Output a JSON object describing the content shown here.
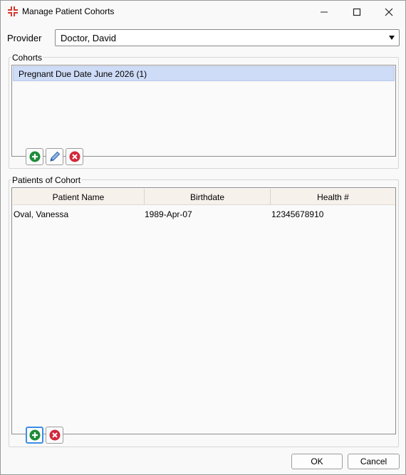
{
  "window": {
    "title": "Manage Patient Cohorts"
  },
  "provider": {
    "label": "Provider",
    "selected": "Doctor, David"
  },
  "cohorts": {
    "label": "Cohorts",
    "items": [
      {
        "label": "Pregnant Due Date June 2026 (1)",
        "selected": true
      }
    ],
    "add_icon": "plus-circle-icon",
    "edit_icon": "pencil-icon",
    "remove_icon": "x-circle-icon"
  },
  "patients": {
    "label": "Patients of Cohort",
    "columns": [
      "Patient Name",
      "Birthdate",
      "Health #"
    ],
    "rows": [
      [
        "Oval, Vanessa",
        "1989-Apr-07",
        "12345678910"
      ]
    ]
  },
  "footer": {
    "ok": "OK",
    "cancel": "Cancel"
  },
  "colors": {
    "selection": "#cfdcf7",
    "add_green": "#1e8b3a",
    "remove_red": "#d3273a",
    "edit_blue": "#3b78c4",
    "focus_blue": "#3c8ee6"
  }
}
